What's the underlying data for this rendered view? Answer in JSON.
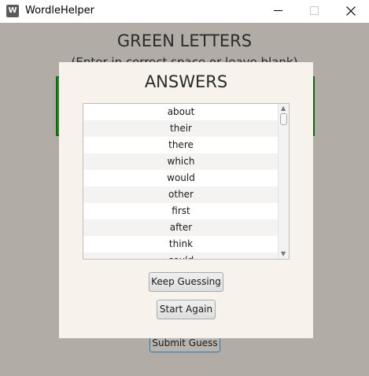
{
  "window": {
    "title": "WordleHelper",
    "icon_letter": "W"
  },
  "background": {
    "heading": "GREEN LETTERS",
    "subheading": "(Enter in correct space or leave blank)",
    "submit_label": "Submit Guess"
  },
  "dialog": {
    "title": "ANSWERS",
    "answers": [
      "about",
      "their",
      "there",
      "which",
      "would",
      "other",
      "first",
      "after",
      "think",
      "could"
    ],
    "keep_guessing_label": "Keep Guessing",
    "start_again_label": "Start Again"
  },
  "colors": {
    "green_box": "#2e8b2e",
    "dialog_bg": "#f7f2ec",
    "backdrop": "#b1ada6"
  }
}
